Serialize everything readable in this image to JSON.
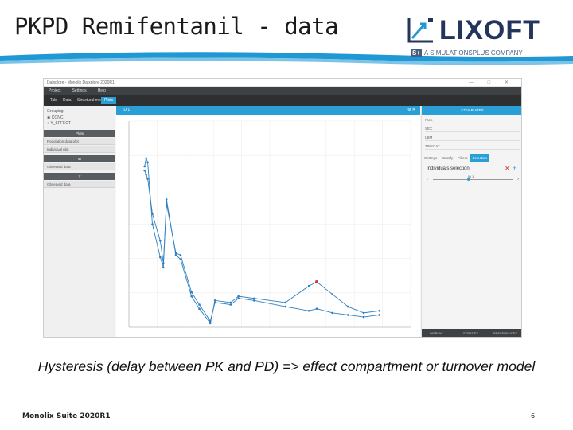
{
  "slide": {
    "title": "PKPD Remifentanil - data",
    "caption": "Hysteresis (delay between PK and PD) => effect compartment or turnover model",
    "footer_left": "Monolix Suite 2020R1",
    "footer_right": "6"
  },
  "logo": {
    "name": "LIXOFT",
    "sub_badge": "S+",
    "sub_text": "A SIMULATIONSPLUS COMPANY",
    "colors": {
      "text": "#23355c",
      "band": "#1f98d4"
    }
  },
  "app": {
    "window_title": "Datxplore - Monolix Datxplore 2020R1",
    "window_controls": "— □ ✕",
    "menu": [
      "Project",
      "Settings",
      "Help"
    ],
    "tabs": [
      {
        "label": "Tab"
      },
      {
        "label": "Data"
      },
      {
        "label": "Structural model"
      },
      {
        "label": "Plots"
      }
    ],
    "left_panel": {
      "radio_title": "Grouping",
      "radios": [
        "CONC",
        "Y_EFFECT"
      ],
      "section_plots": "Plots",
      "items": [
        "Population data plot",
        "Individual plot"
      ],
      "section_2": "ID",
      "item_observed_1": "Observed data",
      "section_3": "Y",
      "item_observed_2": "Observed data"
    },
    "plot": {
      "header_label": "ID 1",
      "header_icons": "⚙ ✕"
    },
    "right_panel": {
      "header": "COVARIATES",
      "fields": [
        "AGE",
        "SEX",
        "LBM",
        "TINFCAT"
      ],
      "tabs": [
        "Settings",
        "Stratify",
        "Filters",
        "Selection"
      ],
      "active_tab": "Selection",
      "selection_label": "Individuals selection",
      "remove_icon": "✕",
      "add_icon": "+",
      "slider_value": "ID 1",
      "slider_fraction": 0.45,
      "prev": "‹",
      "next": "›",
      "bottom_buttons": [
        "DISPLAY",
        "STRATIFY",
        "PREFERENCES"
      ]
    }
  },
  "chart_data": {
    "type": "line",
    "title": "",
    "xlabel": "",
    "ylabel": "",
    "x": [
      1,
      1.1,
      1.2,
      1.5,
      2,
      2.2,
      2.4,
      3,
      3.3,
      4,
      4.5,
      5.2,
      5.5,
      6.5,
      7,
      8,
      10,
      11.5,
      12,
      13,
      14,
      15,
      16
    ],
    "series": [
      {
        "values": [
          0.78,
          0.82,
          0.8,
          0.5,
          0.34,
          0.29,
          0.62,
          0.35,
          0.33,
          0.15,
          0.09,
          0.02,
          0.13,
          0.12,
          0.15,
          0.14,
          0.12,
          0.2,
          0.22,
          0.16,
          0.1,
          0.07,
          0.08
        ]
      },
      {
        "values": [
          0.76,
          0.74,
          0.72,
          0.55,
          0.42,
          0.31,
          0.6,
          0.36,
          0.35,
          0.17,
          0.11,
          0.03,
          0.12,
          0.11,
          0.14,
          0.13,
          0.1,
          0.08,
          0.09,
          0.07,
          0.06,
          0.05,
          0.06
        ]
      }
    ],
    "xlim": [
      0,
      18
    ],
    "ylim": [
      0,
      1
    ],
    "grid": true,
    "colors": {
      "line": "#2d7fc0",
      "point": "#2d7fc0",
      "highlight": "#e03030"
    },
    "highlight_point_index": 18
  }
}
